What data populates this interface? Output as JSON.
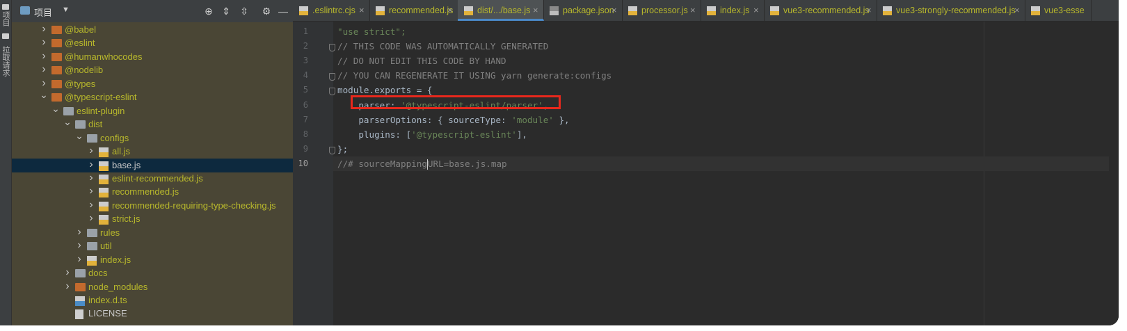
{
  "left_strip": {
    "labels": [
      "项目",
      "拉取请求"
    ]
  },
  "project_panel": {
    "title": "项目",
    "tree": [
      {
        "label": "@babel",
        "type": "folder-orange",
        "arrow": "right"
      },
      {
        "label": "@eslint",
        "type": "folder-orange",
        "arrow": "right"
      },
      {
        "label": "@humanwhocodes",
        "type": "folder-orange",
        "arrow": "right"
      },
      {
        "label": "@nodelib",
        "type": "folder-orange",
        "arrow": "right"
      },
      {
        "label": "@types",
        "type": "folder-orange",
        "arrow": "right"
      },
      {
        "label": "@typescript-eslint",
        "type": "folder-orange",
        "arrow": "down"
      },
      {
        "label": "eslint-plugin",
        "type": "folder-gray",
        "arrow": "down"
      },
      {
        "label": "dist",
        "type": "folder-gray",
        "arrow": "down"
      },
      {
        "label": "configs",
        "type": "folder-gray",
        "arrow": "down"
      },
      {
        "label": "all.js",
        "type": "js",
        "arrow": "right"
      },
      {
        "label": "base.js",
        "type": "js",
        "arrow": "right",
        "selected": true
      },
      {
        "label": "eslint-recommended.js",
        "type": "js",
        "arrow": "right"
      },
      {
        "label": "recommended.js",
        "type": "js",
        "arrow": "right"
      },
      {
        "label": "recommended-requiring-type-checking.js",
        "type": "js",
        "arrow": "right"
      },
      {
        "label": "strict.js",
        "type": "js",
        "arrow": "right"
      },
      {
        "label": "rules",
        "type": "folder-gray",
        "arrow": "right"
      },
      {
        "label": "util",
        "type": "folder-gray",
        "arrow": "right"
      },
      {
        "label": "index.js",
        "type": "js",
        "arrow": "right"
      },
      {
        "label": "docs",
        "type": "folder-gray",
        "arrow": "right"
      },
      {
        "label": "node_modules",
        "type": "folder-orange",
        "arrow": "right"
      },
      {
        "label": "index.d.ts",
        "type": "ts",
        "arrow": ""
      },
      {
        "label": "LICENSE",
        "type": "license",
        "arrow": ""
      }
    ]
  },
  "tabs": [
    {
      "label": ".eslintrc.cjs",
      "icon": "js-file-icon"
    },
    {
      "label": "recommended.js",
      "icon": "js-file-icon"
    },
    {
      "label": "dist/.../base.js",
      "icon": "js-file-icon",
      "active": true
    },
    {
      "label": "package.json",
      "icon": "json-file-icon"
    },
    {
      "label": "processor.js",
      "icon": "js-file-icon"
    },
    {
      "label": "index.js",
      "icon": "js-file-icon"
    },
    {
      "label": "vue3-recommended.js",
      "icon": "js-file-icon"
    },
    {
      "label": "vue3-strongly-recommended.js",
      "icon": "js-file-icon"
    },
    {
      "label": "vue3-esse",
      "icon": "js-file-icon"
    }
  ],
  "code": {
    "current_line": 10,
    "lines": [
      {
        "n": "1",
        "parts": [
          {
            "t": "\"use strict\";",
            "c": "str"
          }
        ]
      },
      {
        "n": "2",
        "parts": [
          {
            "t": "// THIS CODE WAS AUTOMATICALLY GENERATED",
            "c": "cmt"
          }
        ]
      },
      {
        "n": "3",
        "parts": [
          {
            "t": "// DO NOT EDIT THIS CODE BY HAND",
            "c": "cmt"
          }
        ]
      },
      {
        "n": "4",
        "parts": [
          {
            "t": "// YOU CAN REGENERATE IT USING yarn generate:configs",
            "c": "cmt"
          }
        ]
      },
      {
        "n": "5",
        "parts": [
          {
            "t": "module.exports = {",
            "c": ""
          }
        ]
      },
      {
        "n": "6",
        "parts": [
          {
            "t": "    parser: ",
            "c": ""
          },
          {
            "t": "'@typescript-eslint/parser'",
            "c": "str"
          },
          {
            "t": ",",
            "c": ""
          }
        ]
      },
      {
        "n": "7",
        "parts": [
          {
            "t": "    parserOptions: { sourceType: ",
            "c": ""
          },
          {
            "t": "'module'",
            "c": "str"
          },
          {
            "t": " },",
            "c": ""
          }
        ]
      },
      {
        "n": "8",
        "parts": [
          {
            "t": "    plugins: [",
            "c": ""
          },
          {
            "t": "'@typescript-eslint'",
            "c": "str"
          },
          {
            "t": "],",
            "c": ""
          }
        ]
      },
      {
        "n": "9",
        "parts": [
          {
            "t": "};",
            "c": ""
          }
        ]
      },
      {
        "n": "10",
        "parts": [
          {
            "t": "//# sourceMapping",
            "c": "cmt"
          },
          {
            "t": "|caret|",
            "c": "caret"
          },
          {
            "t": "URL=base.js.map",
            "c": "cmt"
          }
        ]
      }
    ]
  },
  "colors": {
    "tree_text": "#b8b82c",
    "highlight_box": "#e8281c",
    "string": "#6a8759",
    "comment": "#808080"
  }
}
